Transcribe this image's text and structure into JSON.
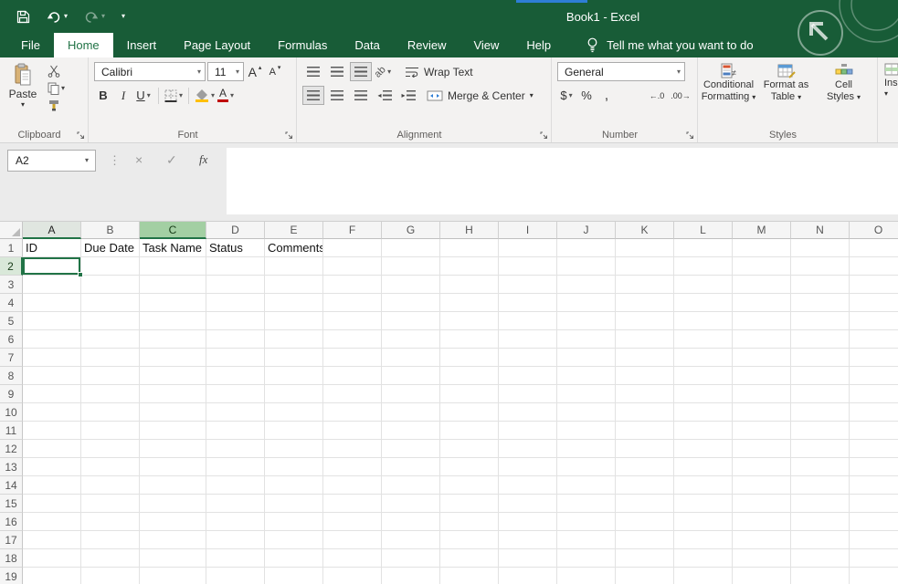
{
  "titlebar": {
    "title": "Book1 - Excel"
  },
  "tabs": [
    {
      "label": "File"
    },
    {
      "label": "Home"
    },
    {
      "label": "Insert"
    },
    {
      "label": "Page Layout"
    },
    {
      "label": "Formulas"
    },
    {
      "label": "Data"
    },
    {
      "label": "Review"
    },
    {
      "label": "View"
    },
    {
      "label": "Help"
    }
  ],
  "tell_me": "Tell me what you want to do",
  "ribbon": {
    "clipboard": {
      "group_label": "Clipboard",
      "paste_label": "Paste"
    },
    "font": {
      "group_label": "Font",
      "font_name": "Calibri",
      "font_size": "11",
      "bold": "B",
      "italic": "I",
      "underline": "U"
    },
    "alignment": {
      "group_label": "Alignment",
      "wrap_text": "Wrap Text",
      "merge_center": "Merge & Center"
    },
    "number": {
      "group_label": "Number",
      "number_format": "General",
      "currency": "$",
      "percent": "%",
      "comma": ","
    },
    "styles": {
      "group_label": "Styles",
      "conditional_1": "Conditional",
      "conditional_2": "Formatting",
      "format_table_1": "Format as",
      "format_table_2": "Table",
      "cell_styles_1": "Cell",
      "cell_styles_2": "Styles"
    },
    "cells": {
      "insert_label": "Insert"
    }
  },
  "formula_bar": {
    "name_box": "A2",
    "fx_label": "fx",
    "formula_value": ""
  },
  "grid": {
    "columns": [
      "A",
      "B",
      "C",
      "D",
      "E",
      "F",
      "G",
      "H",
      "I",
      "J",
      "K",
      "L",
      "M",
      "N",
      "O"
    ],
    "row_count": 19,
    "cells": {
      "A1": "ID",
      "B1": "Due Date",
      "C1": "Task Name",
      "D1": "Status",
      "E1": "Comments"
    },
    "selected_cell": "A2",
    "highlighted_column_gray": "A",
    "highlighted_column_green": "C",
    "highlighted_row": 2
  },
  "icons": {
    "caret": "▾",
    "caret_up": "▴",
    "letter_a": "A",
    "cancel": "×",
    "check": "✓",
    "dots": "⋮",
    "increase_decimal": "←.0",
    "decrease_decimal": ".00→",
    "orientation_text": "ab",
    "triangle_left": "◂",
    "triangle_right": "▸"
  },
  "colors": {
    "title_bar_green": "#185C37",
    "excel_green": "#217346",
    "accent_blue": "#2E7ED5",
    "font_color_red": "#C00000",
    "fill_yellow": "#FFC000",
    "selected_column_green": "#A3CFA3"
  }
}
